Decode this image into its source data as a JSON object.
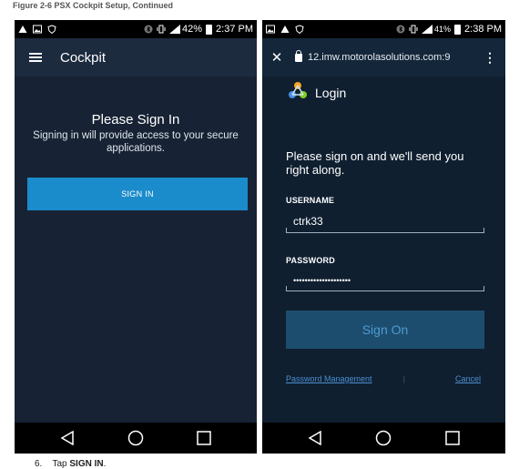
{
  "figure": {
    "caption": "Figure 2-6 PSX Cockpit Setup, Continued"
  },
  "instruction": {
    "number": "6.",
    "prefix": "Tap ",
    "target": "SIGN IN",
    "suffix": "."
  },
  "left_phone": {
    "status": {
      "battery": "42%",
      "time": "2:37 PM"
    },
    "app_title": "Cockpit",
    "heading": "Please Sign In",
    "description": "Signing in will provide access to your secure applications.",
    "signin_button": "SIGN IN"
  },
  "right_phone": {
    "status": {
      "battery": "41%",
      "time": "2:38 PM"
    },
    "url": "12.imw.motorolasolutions.com:9",
    "login_title": "Login",
    "intro": "Please sign on and we'll send you right along.",
    "username_label": "USERNAME",
    "username_value": "ctrk33",
    "password_label": "PASSWORD",
    "password_value": "••••••••••••••••••••",
    "signon_button": "Sign On",
    "password_link": "Password Management",
    "separator": "|",
    "cancel_link": "Cancel"
  },
  "colors": {
    "signin_button": "#1b8ccb",
    "signon_button": "#1d4d6e",
    "link": "#4c8fd0",
    "screen_bg": "#172334"
  }
}
